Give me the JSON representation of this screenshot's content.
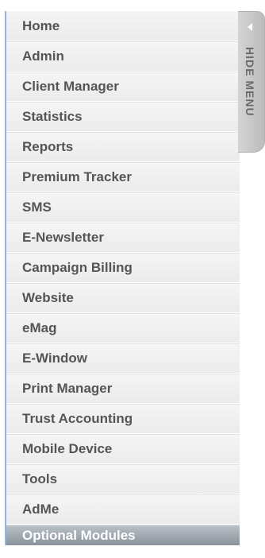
{
  "menu": {
    "items": [
      {
        "label": "Home"
      },
      {
        "label": "Admin"
      },
      {
        "label": "Client Manager"
      },
      {
        "label": "Statistics"
      },
      {
        "label": "Reports"
      },
      {
        "label": "Premium Tracker"
      },
      {
        "label": "SMS"
      },
      {
        "label": "E-Newsletter"
      },
      {
        "label": "Campaign Billing"
      },
      {
        "label": "Website"
      },
      {
        "label": "eMag"
      },
      {
        "label": "E-Window"
      },
      {
        "label": "Print Manager"
      },
      {
        "label": "Trust Accounting"
      },
      {
        "label": "Mobile Device"
      },
      {
        "label": "Tools"
      },
      {
        "label": "AdMe"
      },
      {
        "label": "Optional Modules"
      }
    ]
  },
  "hide_menu": {
    "label": "HIDE MENU",
    "icon": "arrow-left-icon"
  }
}
